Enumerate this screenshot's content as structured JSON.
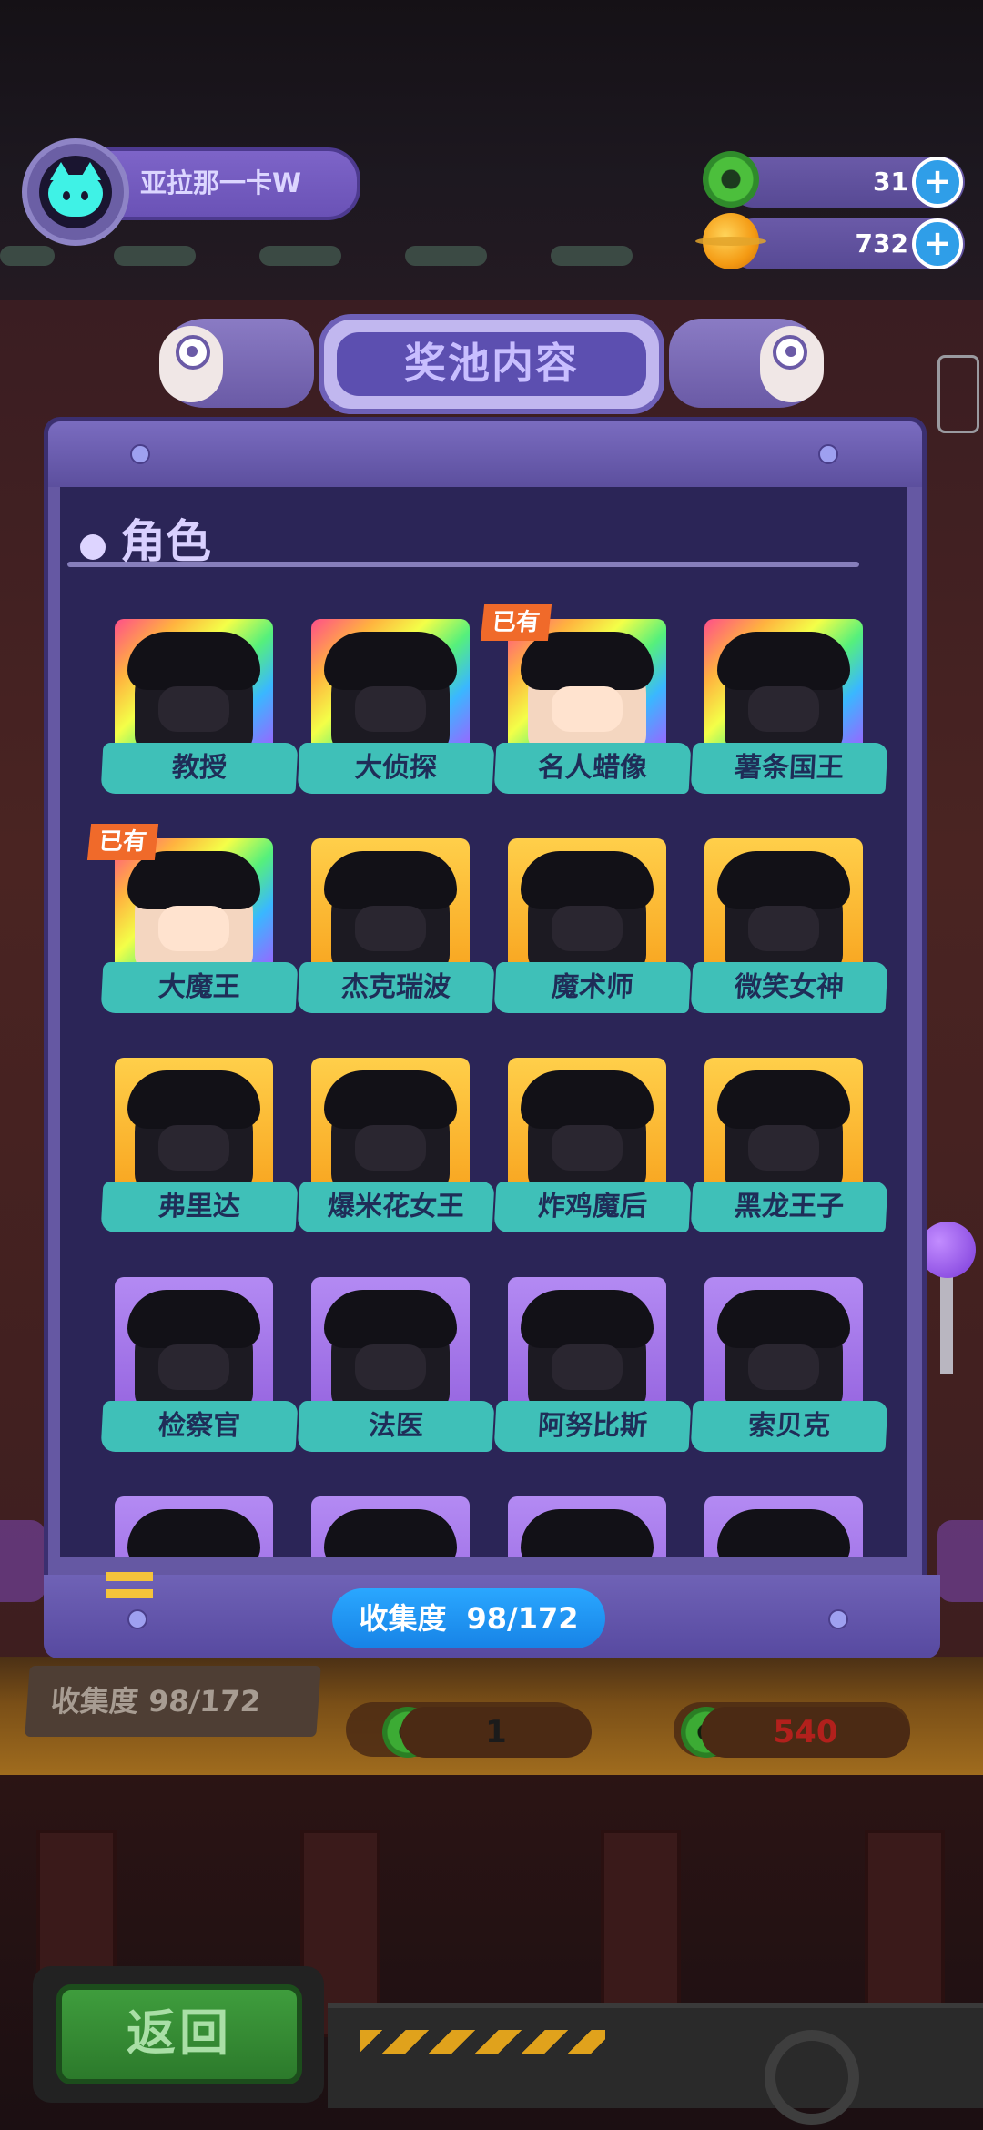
{
  "header": {
    "username": "亚拉那一卡W",
    "currencies": [
      {
        "icon": "donut-coin-icon",
        "value": "31",
        "plus": "+"
      },
      {
        "icon": "planet-coin-icon",
        "value": "732",
        "plus": "+"
      }
    ]
  },
  "modal": {
    "title": "奖池内容",
    "section": "角色",
    "owned_badge": "已有",
    "cards": [
      {
        "name": "教授",
        "tier": "rainbow",
        "owned": false
      },
      {
        "name": "大侦探",
        "tier": "rainbow",
        "owned": false
      },
      {
        "name": "名人蜡像",
        "tier": "rainbow",
        "owned": true
      },
      {
        "name": "薯条国王",
        "tier": "rainbow",
        "owned": false
      },
      {
        "name": "大魔王",
        "tier": "rainbow",
        "owned": true
      },
      {
        "name": "杰克瑞波",
        "tier": "gold",
        "owned": false
      },
      {
        "name": "魔术师",
        "tier": "gold",
        "owned": false
      },
      {
        "name": "微笑女神",
        "tier": "gold",
        "owned": false
      },
      {
        "name": "弗里达",
        "tier": "gold",
        "owned": false
      },
      {
        "name": "爆米花女王",
        "tier": "gold",
        "owned": false
      },
      {
        "name": "炸鸡魔后",
        "tier": "gold",
        "owned": false
      },
      {
        "name": "黑龙王子",
        "tier": "gold",
        "owned": false
      },
      {
        "name": "检察官",
        "tier": "purple",
        "owned": false
      },
      {
        "name": "法医",
        "tier": "purple",
        "owned": false
      },
      {
        "name": "阿努比斯",
        "tier": "purple",
        "owned": false
      },
      {
        "name": "索贝克",
        "tier": "purple",
        "owned": false
      },
      {
        "name": "",
        "tier": "purple",
        "owned": false
      },
      {
        "name": "",
        "tier": "purple",
        "owned": false
      },
      {
        "name": "",
        "tier": "purple",
        "owned": false
      },
      {
        "name": "",
        "tier": "purple",
        "owned": false
      }
    ],
    "collection_label": "收集度",
    "collection_value": "98/172"
  },
  "background": {
    "collection_text": "收集度  98/172",
    "cost_left": "1",
    "cost_right": "540",
    "back_button": "返回"
  },
  "colors": {
    "accent_blue": "#2aa7ff",
    "label_teal": "#3fc0b8",
    "owned_orange": "#f06a2a",
    "panel_navy": "#2b2557"
  }
}
